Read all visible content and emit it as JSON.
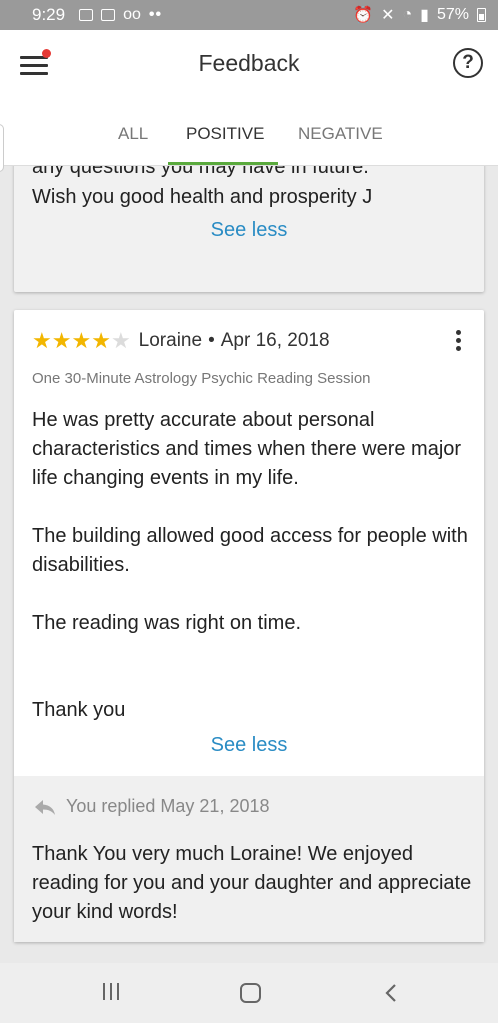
{
  "status_bar": {
    "time": "9:29",
    "left_icons": [
      "image-icon",
      "gallery-icon",
      "voicemail-icon"
    ],
    "dots": "••",
    "battery": "57%",
    "right_icons": [
      "alarm-icon",
      "mute-icon",
      "wifi-icon",
      "signal-icon",
      "battery-icon"
    ]
  },
  "header": {
    "title": "Feedback",
    "help_label": "?"
  },
  "tabs": [
    {
      "label": "ALL"
    },
    {
      "label": "POSITIVE"
    },
    {
      "label": "NEGATIVE"
    }
  ],
  "active_tab": "POSITIVE",
  "colors": {
    "accent_green": "#5aaa3d",
    "link_blue": "#2a8cc4",
    "star_gold": "#f2b600",
    "notification_red": "#e53935"
  },
  "reviews": [
    {
      "cut_text": "any questions you may have in future.",
      "body_last": "Wish you good health and prosperity J",
      "see_less": "See less"
    },
    {
      "rating": 4,
      "rating_max": 5,
      "reviewer": "Loraine",
      "date": "Apr 16, 2018",
      "separator": "•",
      "service": "One 30-Minute Astrology Psychic Reading Session",
      "paragraphs": [
        "He was pretty accurate about personal characteristics and times when there were major life changing events in my life.",
        "The building allowed good access for people with disabilities.",
        "The reading was right on time.",
        "Thank you"
      ],
      "see_less": "See less",
      "reply": {
        "label": "You replied May 21, 2018",
        "text": "Thank You very much Loraine! We enjoyed reading for you and your daughter and appreciate your kind words!"
      }
    }
  ]
}
